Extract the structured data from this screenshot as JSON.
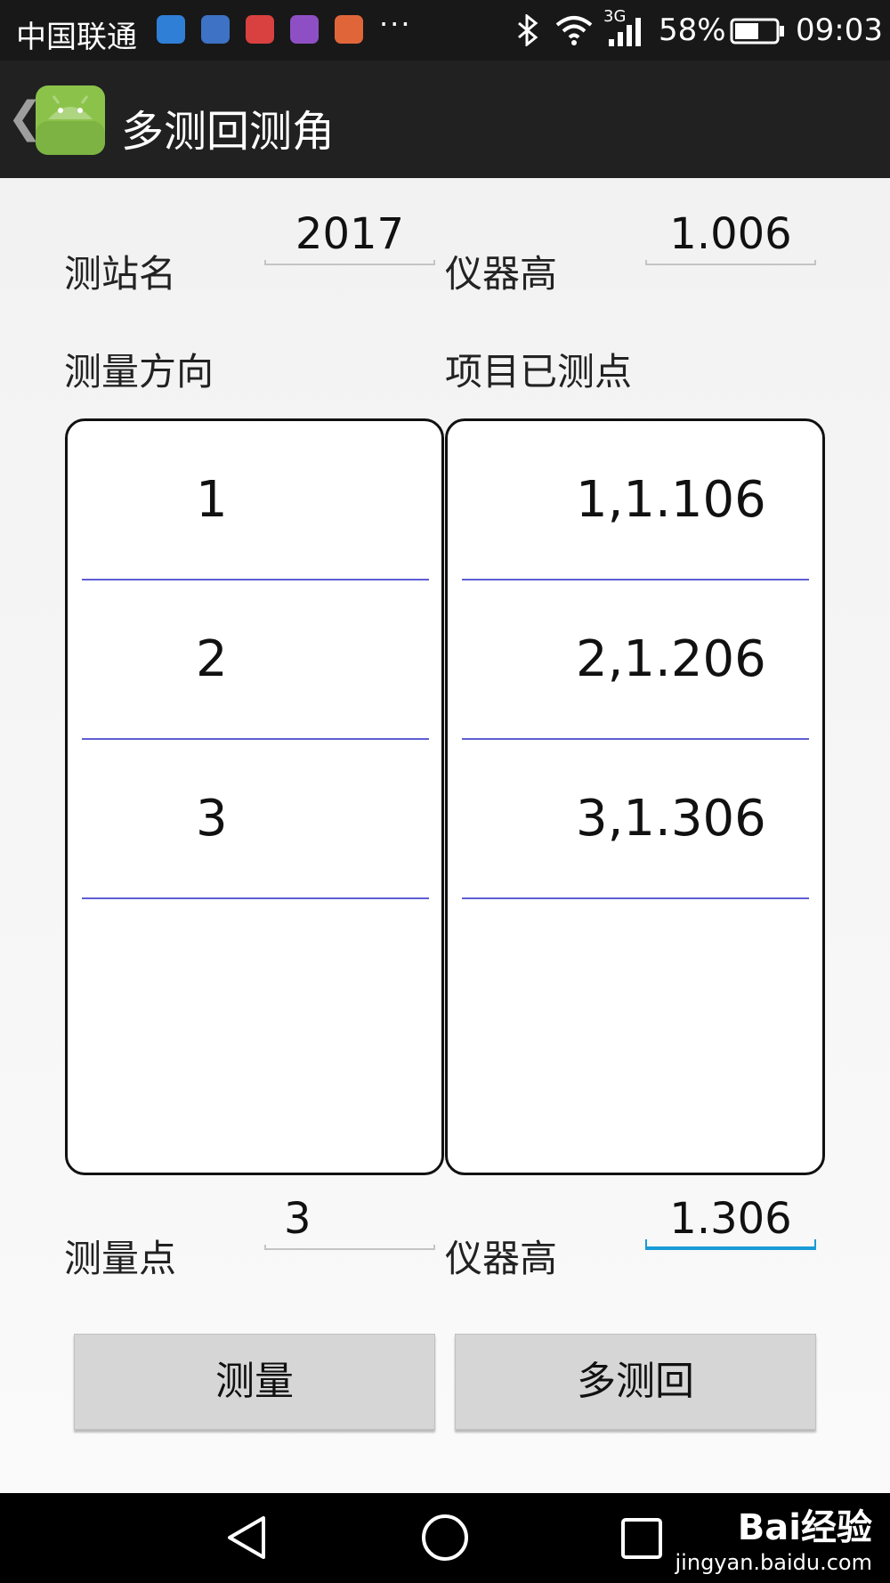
{
  "status_bar": {
    "carrier": "中国联通",
    "battery": "58%",
    "network": "3G",
    "time": "09:03",
    "more": "···"
  },
  "action_bar": {
    "title": "多测回测角",
    "back_icon": "chevron-left-icon",
    "app_icon": "android-icon"
  },
  "station": {
    "name_label": "测站名",
    "name_value": "2017",
    "height_label": "仪器高",
    "height_value": "1.006"
  },
  "directions": {
    "label": "测量方向",
    "items": [
      "1",
      "2",
      "3"
    ]
  },
  "measured_points": {
    "label": "项目已测点",
    "items": [
      "1,1.106",
      "2,1.206",
      "3,1.306"
    ]
  },
  "point": {
    "label": "测量点",
    "value": "3",
    "height_label": "仪器高",
    "height_value": "1.306"
  },
  "buttons": {
    "measure": "测量",
    "multi_round": "多测回"
  },
  "nav_bar": {
    "icons": [
      "back-triangle-icon",
      "home-circle-icon",
      "recents-square-icon"
    ]
  },
  "watermark": {
    "main": "Bai经验",
    "sub": "jingyan.baidu.com"
  },
  "colors": {
    "action_bar": "#212121",
    "focus_underline": "#1a9ad6",
    "list_divider": "#5e5ed6",
    "button": "#d6d6d6"
  }
}
